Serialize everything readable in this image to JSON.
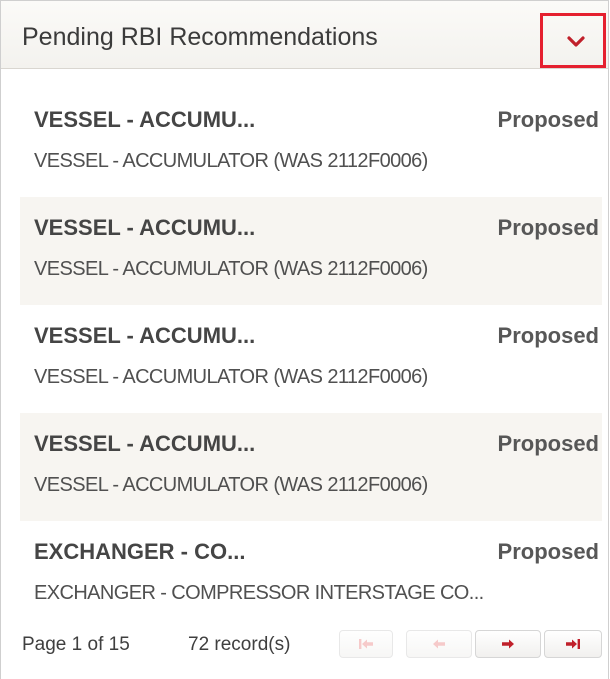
{
  "header": {
    "title": "Pending RBI Recommendations",
    "toggle_icon": "chevron-down-icon"
  },
  "colors": {
    "accent": "#c0202b",
    "highlight_border": "#e5202f",
    "disabled_icon": "#f0a0a0",
    "alt_row": "#f7f5f1"
  },
  "items": [
    {
      "title": "VESSEL - ACCUMU...",
      "status": "Proposed",
      "subtitle": "VESSEL - ACCUMULATOR (WAS 2112F0006)"
    },
    {
      "title": "VESSEL - ACCUMU...",
      "status": "Proposed",
      "subtitle": "VESSEL - ACCUMULATOR (WAS 2112F0006)"
    },
    {
      "title": "VESSEL - ACCUMU...",
      "status": "Proposed",
      "subtitle": "VESSEL - ACCUMULATOR (WAS 2112F0006)"
    },
    {
      "title": "VESSEL - ACCUMU...",
      "status": "Proposed",
      "subtitle": "VESSEL - ACCUMULATOR (WAS 2112F0006)"
    },
    {
      "title": "EXCHANGER - CO...",
      "status": "Proposed",
      "subtitle": "EXCHANGER - COMPRESSOR INTERSTAGE CO..."
    }
  ],
  "pager": {
    "page_info": "Page 1 of 15",
    "record_count": "72 record(s)",
    "buttons": [
      {
        "icon": "first-page-icon",
        "enabled": false
      },
      {
        "icon": "previous-page-icon",
        "enabled": false
      },
      {
        "icon": "next-page-icon",
        "enabled": true
      },
      {
        "icon": "last-page-icon",
        "enabled": true
      }
    ]
  }
}
